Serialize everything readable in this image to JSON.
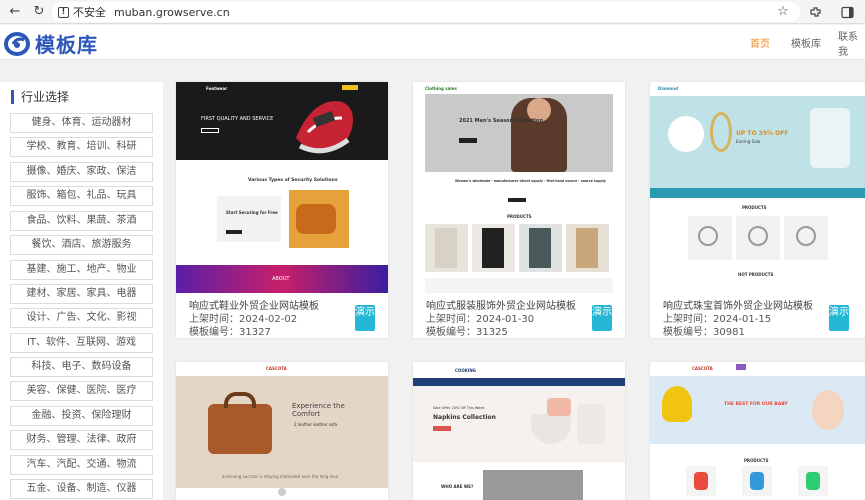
{
  "browser": {
    "security_label": "不安全",
    "url": "muban.growserve.cn"
  },
  "site": {
    "logo_text": "模板库",
    "nav": [
      {
        "label": "首页"
      },
      {
        "label": "模板库"
      },
      {
        "label": "联系我"
      }
    ]
  },
  "sidebar": {
    "title": "行业选择",
    "items": [
      {
        "label": "健身、体育、运动器材"
      },
      {
        "label": "学校、教育、培训、科研"
      },
      {
        "label": "摄像、婚庆、家政、保洁"
      },
      {
        "label": "服饰、箱包、礼品、玩具"
      },
      {
        "label": "食品、饮料、果蔬、茶酒"
      },
      {
        "label": "餐饮、酒店、旅游服务"
      },
      {
        "label": "基建、施工、地产、物业"
      },
      {
        "label": "建材、家居、家具、电器"
      },
      {
        "label": "设计、广告、文化、影视"
      },
      {
        "label": "IT、软件、互联网、游戏"
      },
      {
        "label": "科技、电子、数码设备"
      },
      {
        "label": "美容、保健、医院、医疗"
      },
      {
        "label": "金融、投资、保险理财"
      },
      {
        "label": "财务、管理、法律、政府"
      },
      {
        "label": "汽车、汽配、交通、物流"
      },
      {
        "label": "五金、设备、制造、仪器"
      }
    ]
  },
  "cards": [
    {
      "title": "响应式鞋业外贸企业网站模板",
      "date": "上架时间：2024-02-02",
      "code": "模板编号：31327",
      "preview_label": "演示",
      "thumb": {
        "brand": "Footwear",
        "hero": "FIRST QUALITY AND SERVICE",
        "section": "Various Types of Security Solutions",
        "sub": "Start Securing for Free",
        "about": "ABOUT"
      }
    },
    {
      "title": "响应式服装服饰外贸企业网站模板",
      "date": "上架时间：2024-01-30",
      "code": "模板编号：31325",
      "preview_label": "演示",
      "thumb": {
        "brand": "Clothing sales",
        "hero": "2021 Men's Season Collection",
        "tag": "Women's wholesale - manufacturer direct supply - first-hand source - source supply",
        "section": "PRODUCTS"
      }
    },
    {
      "title": "响应式珠宝首饰外贸企业网站模板",
      "date": "上架时间：2024-01-15",
      "code": "模板编号：30981",
      "preview_label": "演示",
      "thumb": {
        "brand": "Diamond",
        "hero": "UP TO 35% OFF",
        "hero_sub": "Earring Sale",
        "section": "PRODUCTS",
        "section2": "HOT PRODUCTS"
      }
    },
    {
      "thumb": {
        "brand": "CASCOTA",
        "hero": "Experience the Comfort",
        "hero_sub": "2 leather leather sofa",
        "caption": "achieving success is staying motivated over the long haul"
      }
    },
    {
      "thumb": {
        "brand": "COOKING",
        "hero_small": "Sale Offer 20% Off This Week",
        "hero": "Napkins Collection",
        "section": "WHO ARE WE?"
      }
    },
    {
      "thumb": {
        "brand": "CASCOTA",
        "hero": "THE BEST FOR OUR BABY",
        "section": "PRODUCTS"
      }
    }
  ]
}
